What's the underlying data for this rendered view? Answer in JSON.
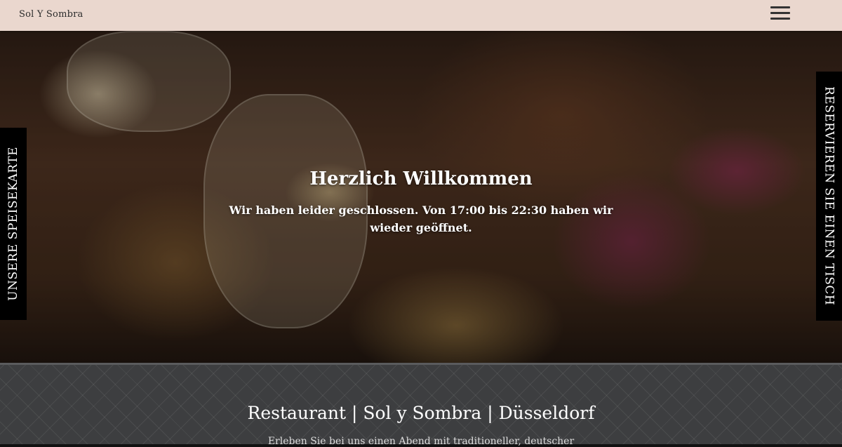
{
  "header": {
    "brand": "Sol Y Sombra",
    "menu_icon": "hamburger-menu-icon"
  },
  "hero": {
    "title": "Herzlich Willkommen",
    "message": "Wir haben leider geschlossen. Von 17:00 bis 22:30 haben wir wieder geöffnet."
  },
  "side_tabs": {
    "left_label": "UNSERE SPEISEKARTE",
    "right_label": "RESERVIEREN SIE EINEN TISCH"
  },
  "section": {
    "title": "Restaurant | Sol y Sombra | Düsseldorf",
    "intro": "Erleben Sie bei uns einen Abend mit traditioneller, deutscher"
  },
  "colors": {
    "header_bg": "#ead7ce",
    "side_tab_bg": "#000000",
    "section_bg": "#3d3e40"
  }
}
